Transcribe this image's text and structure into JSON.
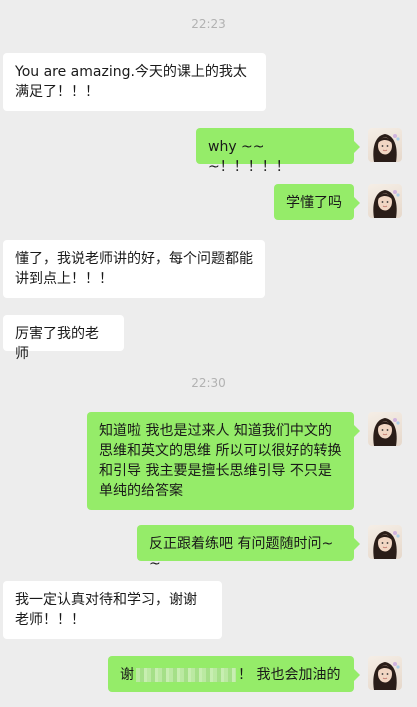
{
  "messages": {
    "time1": "22:23",
    "m1": "You are amazing.今天的课上的我太满足了！！！",
    "m2": "why ~~~！！！！！",
    "m3": "学懂了吗",
    "m4": "懂了，我说老师讲的好，每个问题都能讲到点上！！！",
    "m5": "厉害了我的老师",
    "time2": "22:30",
    "m6": "知道啦 我也是过来人 知道我们中文的思维和英文的思维 所以可以很好的转换和引导 我主要是擅长思维引导 不只是单纯的给答案",
    "m7": "反正跟着练吧 有问题随时问~~",
    "m8": "我一定认真对待和学习，谢谢老师！！！",
    "m9_prefix": "谢",
    "m9_suffix": "！ 我也会加油的"
  }
}
